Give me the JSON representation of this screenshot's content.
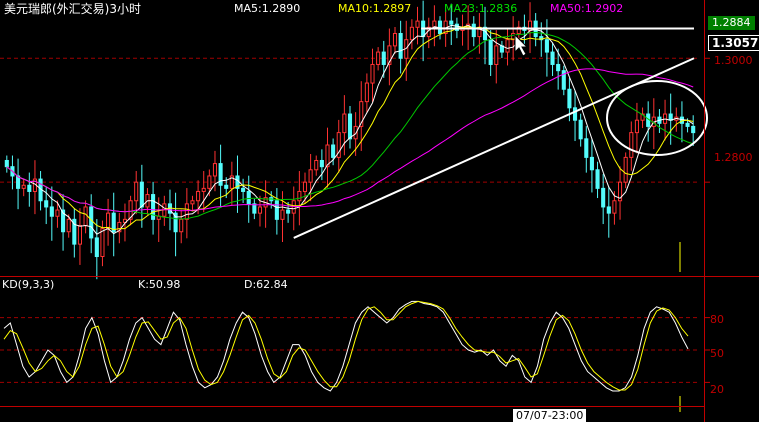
{
  "header": {
    "symbol": "美元瑞郎(外汇交易)3小时",
    "ma5": "MA5:1.2890",
    "ma10": "MA10:1.2897",
    "ma23": "MA23:1.2836",
    "ma50": "MA50:1.2902"
  },
  "colors": {
    "background": "#000000",
    "candle_up": "#ff3232",
    "candle_down": "#54fcfc",
    "ma5": "#ffffff",
    "ma10": "#ffff00",
    "ma23": "#00c800",
    "ma50": "#ff00ff",
    "grid": "#a00000",
    "axis": "#c00000",
    "trendline": "#ffffff",
    "k_line": "#ffffff",
    "d_line": "#ffff00",
    "axis_label": "#c00000",
    "kd_label": "#ffffff"
  },
  "price_axis": {
    "labels": [
      "1.3000",
      "1.2800"
    ],
    "last_price": "1.3057",
    "cursor_price": "1.2884"
  },
  "kd": {
    "title": "KD(9,3,3)",
    "k": "K:50.98",
    "d": "D:62.84",
    "levels": [
      "80",
      "50",
      "20"
    ]
  },
  "time_axis": {
    "cursor_label": "07/07-23:00"
  },
  "chart_data": [
    {
      "type": "candlestick",
      "title": "美元瑞郎(外汇交易)3小时",
      "ylim": [
        1.2655,
        1.3065
      ],
      "grid_y": [
        1.3,
        1.28
      ],
      "moving_averages": [
        "MA5",
        "MA10",
        "MA23",
        "MA50"
      ],
      "closes": [
        1.2825,
        1.281,
        1.279,
        1.2795,
        1.2785,
        1.2805,
        1.277,
        1.276,
        1.2745,
        1.2755,
        1.272,
        1.274,
        1.27,
        1.273,
        1.276,
        1.271,
        1.268,
        1.2725,
        1.275,
        1.272,
        1.2735,
        1.274,
        1.277,
        1.28,
        1.276,
        1.278,
        1.274,
        1.2745,
        1.2765,
        1.275,
        1.272,
        1.274,
        1.2765,
        1.277,
        1.2785,
        1.279,
        1.281,
        1.283,
        1.2795,
        1.279,
        1.281,
        1.279,
        1.2785,
        1.2765,
        1.275,
        1.276,
        1.2775,
        1.277,
        1.274,
        1.2755,
        1.275,
        1.277,
        1.2785,
        1.28,
        1.282,
        1.2835,
        1.2825,
        1.286,
        1.284,
        1.288,
        1.291,
        1.287,
        1.289,
        1.293,
        1.296,
        1.299,
        1.301,
        1.299,
        1.302,
        1.304,
        1.3,
        1.303,
        1.305,
        1.306,
        1.3035,
        1.305,
        1.306,
        1.304,
        1.306,
        1.3055,
        1.3045,
        1.305,
        1.3055,
        1.3035,
        1.305,
        1.303,
        1.299,
        1.302,
        1.301,
        1.303,
        1.304,
        1.305,
        1.3045,
        1.306,
        1.3035,
        1.303,
        1.301,
        1.299,
        1.298,
        1.295,
        1.292,
        1.29,
        1.287,
        1.284,
        1.282,
        1.279,
        1.276,
        1.275,
        1.277,
        1.28,
        1.284,
        1.288,
        1.29,
        1.291,
        1.289,
        1.2905,
        1.2895,
        1.291,
        1.29,
        1.2905,
        1.2895,
        1.289,
        1.288
      ],
      "trendlines": [
        {
          "from_bar": 74,
          "to_bar": 124,
          "value": 1.3048
        },
        {
          "from_bar": 51,
          "to_bar": 124,
          "from_value": 1.271,
          "to_value": 1.3
        }
      ]
    },
    {
      "type": "line",
      "title": "KD(9,3,3)",
      "ylim": [
        0,
        100
      ],
      "levels": [
        80,
        50,
        20
      ],
      "series": [
        {
          "name": "K",
          "values": [
            70,
            75,
            55,
            35,
            25,
            30,
            40,
            50,
            45,
            30,
            20,
            25,
            45,
            70,
            80,
            65,
            40,
            20,
            25,
            40,
            60,
            75,
            80,
            70,
            60,
            55,
            70,
            85,
            78,
            55,
            35,
            20,
            15,
            18,
            25,
            40,
            60,
            75,
            85,
            80,
            65,
            45,
            30,
            20,
            25,
            40,
            55,
            55,
            45,
            30,
            20,
            15,
            12,
            20,
            35,
            55,
            75,
            85,
            90,
            85,
            80,
            75,
            80,
            88,
            92,
            95,
            95,
            93,
            92,
            90,
            85,
            75,
            65,
            55,
            50,
            48,
            50,
            45,
            50,
            40,
            35,
            45,
            40,
            25,
            20,
            35,
            60,
            75,
            85,
            80,
            70,
            55,
            40,
            30,
            25,
            20,
            15,
            12,
            12,
            15,
            25,
            45,
            70,
            85,
            90,
            88,
            85,
            75,
            62,
            50.98
          ]
        },
        {
          "name": "D",
          "values": [
            60,
            68,
            65,
            52,
            38,
            30,
            33,
            40,
            45,
            40,
            30,
            25,
            35,
            55,
            70,
            72,
            55,
            35,
            25,
            30,
            45,
            62,
            75,
            76,
            68,
            60,
            62,
            75,
            80,
            70,
            50,
            32,
            22,
            18,
            20,
            30,
            45,
            62,
            78,
            82,
            75,
            60,
            42,
            28,
            24,
            30,
            45,
            52,
            50,
            40,
            30,
            22,
            16,
            16,
            25,
            40,
            60,
            78,
            88,
            90,
            85,
            78,
            78,
            84,
            90,
            93,
            95,
            94,
            93,
            91,
            88,
            80,
            70,
            62,
            55,
            50,
            49,
            48,
            48,
            44,
            38,
            40,
            42,
            34,
            25,
            28,
            45,
            63,
            78,
            82,
            77,
            65,
            50,
            38,
            30,
            25,
            20,
            16,
            13,
            13,
            18,
            32,
            55,
            75,
            86,
            89,
            87,
            80,
            70,
            62.84
          ]
        }
      ]
    }
  ]
}
